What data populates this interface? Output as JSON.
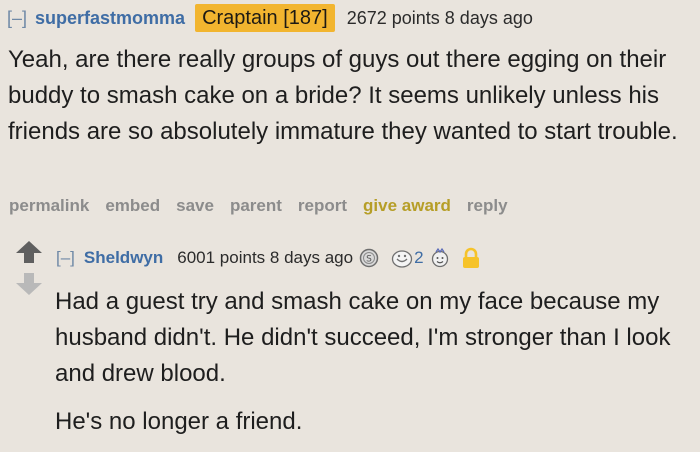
{
  "parent_comment": {
    "collapse": "[–]",
    "author": "superfastmomma",
    "flair": "Craptain [187]",
    "score": "2672 points",
    "time": "8 days ago",
    "body": "Yeah, are there really groups of guys out there egging on their buddy to smash cake on a bride? It seems unlikely unless his friends are so absolutely immature they wanted to start trouble.",
    "buttons": {
      "permalink": "permalink",
      "embed": "embed",
      "save": "save",
      "parent": "parent",
      "report": "report",
      "give_award": "give award",
      "reply": "reply"
    }
  },
  "child_comment": {
    "collapse": "[–]",
    "author": "Sheldwyn",
    "score": "6001 points",
    "time": "8 days ago",
    "awards": {
      "silver_icon": "silver-coin-icon",
      "helpful_icon": "helpful-award-icon",
      "helpful_count": "2",
      "wholesome_icon": "wholesome-award-icon",
      "locked_icon": "lock-icon"
    },
    "paragraphs": [
      "Had a guest try and smash cake on my face because my husband didn't. He didn't succeed, I'm stronger than I look and drew blood.",
      "He's no longer a friend."
    ]
  },
  "colors": {
    "background": "#e9e4dd",
    "author": "#3f6da5",
    "flair_bg": "#f2b52f",
    "button_text": "#8c8c8c",
    "give_award": "#b69e27",
    "vote_arrow_up": "#5f5f5f",
    "vote_arrow_down": "#b9b9b9",
    "lock": "#f6c32a"
  }
}
